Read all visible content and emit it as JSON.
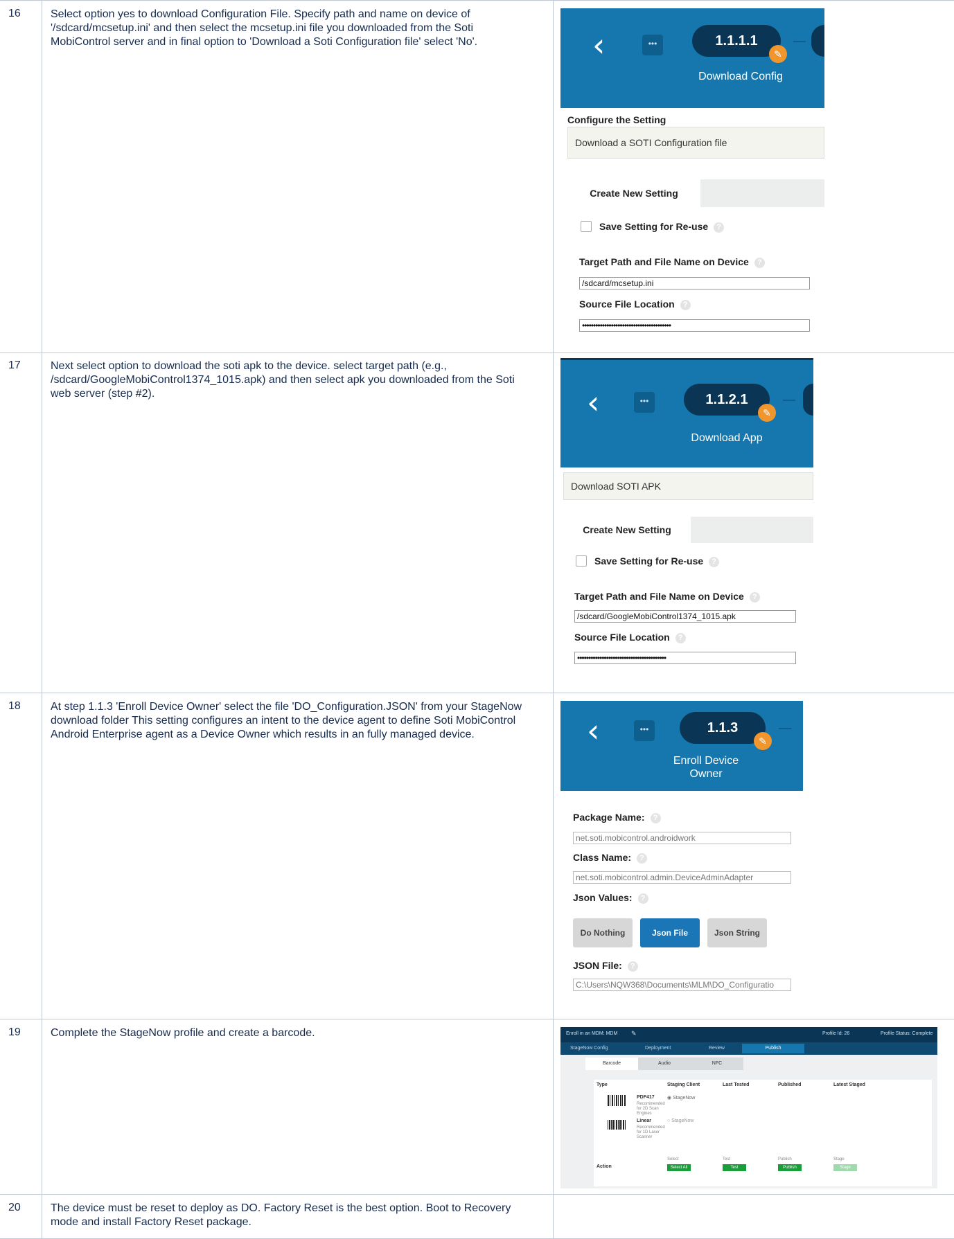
{
  "steps": [
    {
      "number": "16",
      "description": "Select option yes to download Configuration File. Specify path and name on device of '/sdcard/mcsetup.ini' and then select the mcsetup.ini file you downloaded from the Soti MobiControl server and in final option to 'Download a Soti Configuration file' select 'No'.",
      "shot": {
        "step_badge": "1.1.1.1",
        "step_title": "Download Config",
        "section_title": "Configure the Setting",
        "selected_setting": "Download a SOTI Configuration file",
        "tab_label": "Create New Setting",
        "reuse_label": "Save Setting for Re-use",
        "target_label": "Target Path and File Name on Device",
        "target_value": "/sdcard/mcsetup.ini",
        "source_label": "Source File Location",
        "source_value": "••••••••••••••••••••••••••••••••••••••••"
      }
    },
    {
      "number": "17",
      "description": "Next select option to download the soti apk to the device. select target path (e.g., /sdcard/GoogleMobiControl1374_1015.apk) and then select apk you downloaded from the Soti web server (step #2).",
      "shot": {
        "step_badge": "1.1.2.1",
        "step_title": "Download App",
        "selected_setting": "Download SOTI APK",
        "tab_label": "Create New Setting",
        "reuse_label": "Save Setting for Re-use",
        "target_label": "Target Path and File Name on Device",
        "target_value": "/sdcard/GoogleMobiControl1374_1015.apk",
        "source_label": "Source File Location",
        "source_value": "••••••••••••••••••••••••••••••••••••••••"
      }
    },
    {
      "number": "18",
      "description": "At step 1.1.3 'Enroll Device Owner' select the file 'DO_Configuration.JSON' from your StageNow download folder This setting configures an intent to the device agent to define Soti MobiControl Android Enterprise agent as a Device Owner which results in an fully managed device.",
      "shot": {
        "step_badge": "1.1.3",
        "step_title_line1": "Enroll Device",
        "step_title_line2": "Owner",
        "package_label": "Package Name:",
        "package_value": "net.soti.mobicontrol.androidwork",
        "class_label": "Class Name:",
        "class_value": "net.soti.mobicontrol.admin.DeviceAdminAdapter",
        "json_values_label": "Json Values:",
        "btn_do_nothing": "Do Nothing",
        "btn_json_file": "Json File",
        "btn_json_string": "Json String",
        "json_file_label": "JSON File:",
        "json_file_value": "C:\\Users\\NQW368\\Documents\\MLM\\DO_Configuratio"
      }
    },
    {
      "number": "19",
      "description": "Complete the StageNow profile and create a barcode.",
      "shot": {
        "profile_title": "Enroll in an MDM: MDM",
        "profile_id": "Profile Id: 26",
        "profile_status": "Profile Status: Complete",
        "wizard_steps": [
          "StageNow Config",
          "Deployment",
          "Review",
          "Publish"
        ],
        "tabs": [
          "Barcode",
          "Audio",
          "NFC"
        ],
        "columns": [
          "Type",
          "Staging Client",
          "Last Tested",
          "Published",
          "Latest Staged"
        ],
        "rows": [
          {
            "type": "PDF417",
            "note": "Recommended for 2D Scan Engines",
            "client": "StageNow"
          },
          {
            "type": "Linear",
            "note": "Recommended for 1D Laser Scanner",
            "client": "StageNow"
          }
        ],
        "action_label": "Action",
        "actions": [
          {
            "caption": "Select",
            "button": "Select All"
          },
          {
            "caption": "Test",
            "button": "Test"
          },
          {
            "caption": "Publish",
            "button": "Publish"
          },
          {
            "caption": "Stage",
            "button": "Stage"
          }
        ]
      }
    },
    {
      "number": "20",
      "description": "The device must be reset to deploy as DO. Factory Reset is the best option. Boot to Recovery mode and install Factory Reset package."
    }
  ]
}
